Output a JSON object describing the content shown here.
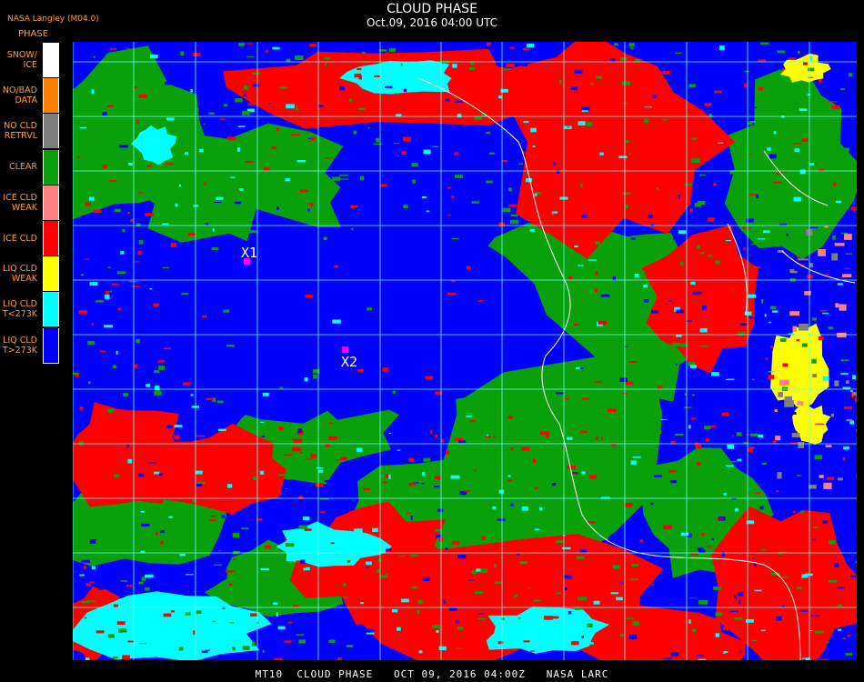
{
  "header": {
    "title": "CLOUD PHASE",
    "subtitle": "Oct.09, 2016 04:00 UTC",
    "source": "NASA Langley (M04.0)"
  },
  "legend": {
    "title": "PHASE",
    "items": [
      {
        "line1": "SNOW/",
        "line2": "ICE",
        "color": "#ffffff"
      },
      {
        "line1": "NO/BAD",
        "line2": "DATA",
        "color": "#ff7f00"
      },
      {
        "line1": "NO CLD",
        "line2": "RETRVL",
        "color": "#7f7f7f"
      },
      {
        "line1": "CLEAR",
        "line2": "",
        "color": "#0aa00a"
      },
      {
        "line1": "ICE CLD",
        "line2": "WEAK",
        "color": "#ff8080"
      },
      {
        "line1": "ICE CLD",
        "line2": "",
        "color": "#ff0000"
      },
      {
        "line1": "LIQ CLD",
        "line2": "WEAK",
        "color": "#ffff00"
      },
      {
        "line1": "LIQ CLD",
        "line2": "T<273K",
        "color": "#00ffff"
      },
      {
        "line1": "LIQ CLD",
        "line2": "T>273K",
        "color": "#0000ff"
      }
    ]
  },
  "map": {
    "markers": [
      {
        "label": "X1",
        "color": "#ff00ff"
      },
      {
        "label": "X2",
        "color": "#ff00ff"
      }
    ],
    "grid_color": "#66ffff",
    "coast_color": "#ffffff"
  },
  "footer": {
    "text": "MT10  CLOUD PHASE   OCT 09, 2016 04:00Z   NASA LARC"
  }
}
